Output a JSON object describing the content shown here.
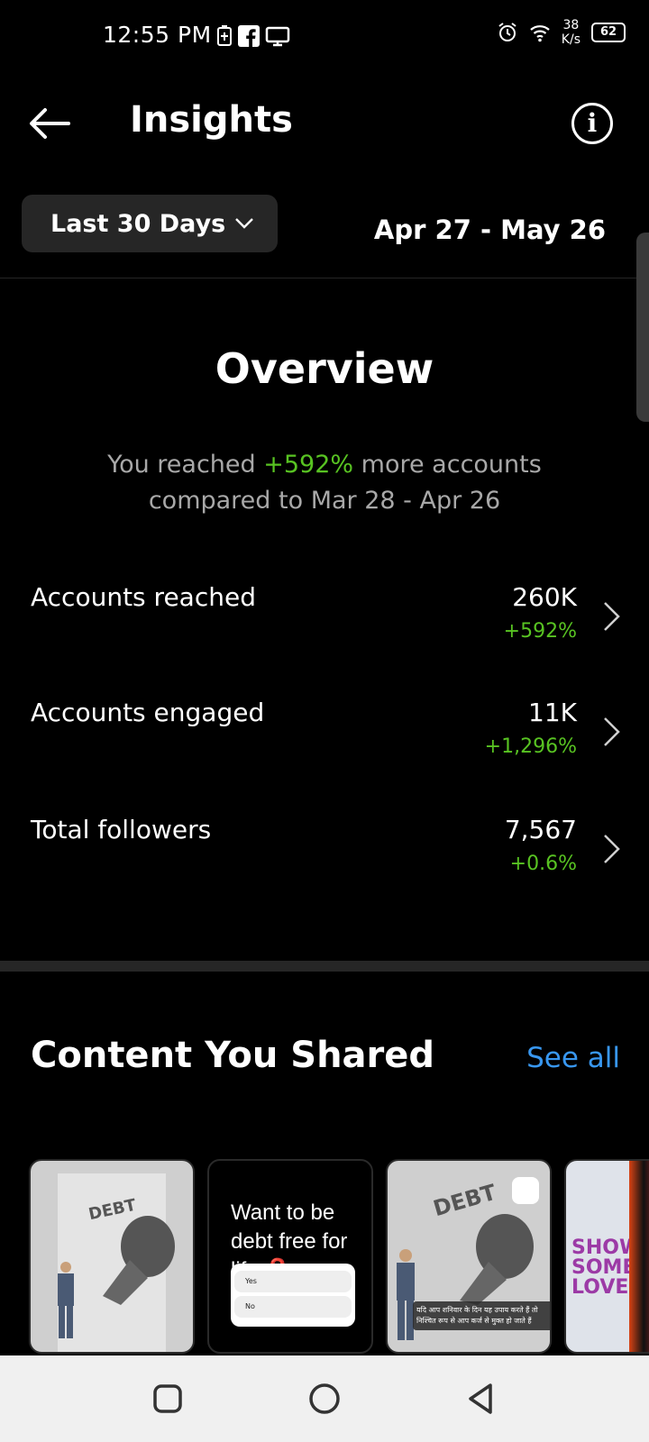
{
  "status_bar": {
    "time": "12:55 PM",
    "speed_value": "38",
    "speed_unit": "K/s",
    "battery": "62",
    "icons": [
      "battery-saver-icon",
      "facebook-icon",
      "screen-icon",
      "alarm-icon",
      "wifi-icon",
      "battery-icon"
    ]
  },
  "header": {
    "title": "Insights",
    "back_icon": "back-arrow-icon",
    "info_icon": "info-icon",
    "info_glyph": "i"
  },
  "range": {
    "selected": "Last 30 Days",
    "date_range": "Apr 27 - May 26"
  },
  "overview": {
    "title": "Overview",
    "summary_prefix": "You reached ",
    "summary_highlight": "+592%",
    "summary_suffix": " more accounts",
    "summary_line2": "compared to Mar 28 - Apr 26",
    "metrics": [
      {
        "label": "Accounts reached",
        "value": "260K",
        "delta": "+592%"
      },
      {
        "label": "Accounts engaged",
        "value": "11K",
        "delta": "+1,296%"
      },
      {
        "label": "Total followers",
        "value": "7,567",
        "delta": "+0.6%"
      }
    ]
  },
  "content": {
    "title": "Content You Shared",
    "see_all": "See all",
    "thumbs": [
      {
        "text": "DEBT"
      },
      {
        "text": "Want to be debt free for life",
        "emoji": "❓",
        "options": [
          "Yes",
          "No"
        ]
      },
      {
        "text": "DEBT",
        "caption": "यदि आप शनिवार के दिन यह उपाय करते हैं तो निश्चित रूप से आप कर्ज से मुक्त हो जाते हैं"
      },
      {
        "text": "SHOW SOME LOVE"
      }
    ]
  },
  "colors": {
    "accent_green": "#58c322",
    "link_blue": "#3897f0",
    "muted_text": "#a8a8a8"
  }
}
